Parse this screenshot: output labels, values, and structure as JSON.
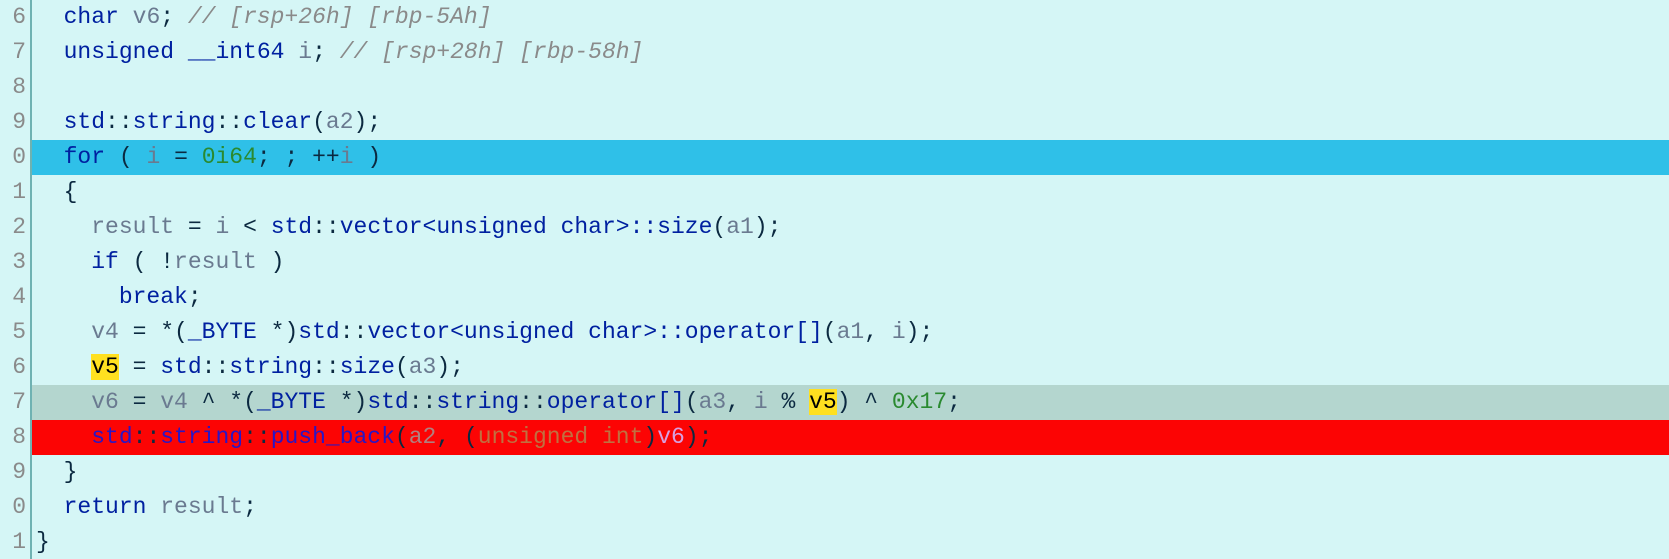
{
  "editor": {
    "first_line": 6,
    "lines": [
      {
        "num": "6",
        "row_class": "",
        "tokens": [
          {
            "cls": "",
            "t": "  "
          },
          {
            "cls": "tk-kw",
            "t": "char"
          },
          {
            "cls": "",
            "t": " "
          },
          {
            "cls": "tk-id",
            "t": "v6"
          },
          {
            "cls": "",
            "t": "; "
          },
          {
            "cls": "tk-cmt",
            "t": "// [rsp+26h] [rbp-5Ah]"
          }
        ]
      },
      {
        "num": "7",
        "row_class": "",
        "tokens": [
          {
            "cls": "",
            "t": "  "
          },
          {
            "cls": "tk-kw",
            "t": "unsigned"
          },
          {
            "cls": "",
            "t": " "
          },
          {
            "cls": "tk-kw",
            "t": "__int64"
          },
          {
            "cls": "",
            "t": " "
          },
          {
            "cls": "tk-id",
            "t": "i"
          },
          {
            "cls": "",
            "t": "; "
          },
          {
            "cls": "tk-cmt",
            "t": "// [rsp+28h] [rbp-58h]"
          }
        ]
      },
      {
        "num": "8",
        "row_class": "",
        "tokens": []
      },
      {
        "num": "9",
        "row_class": "",
        "tokens": [
          {
            "cls": "",
            "t": "  "
          },
          {
            "cls": "tk-func",
            "t": "std"
          },
          {
            "cls": "tk-punc",
            "t": "::"
          },
          {
            "cls": "tk-func",
            "t": "string"
          },
          {
            "cls": "tk-punc",
            "t": "::"
          },
          {
            "cls": "tk-func",
            "t": "clear"
          },
          {
            "cls": "tk-punc",
            "t": "("
          },
          {
            "cls": "tk-arg",
            "t": "a2"
          },
          {
            "cls": "tk-punc",
            "t": ");"
          }
        ]
      },
      {
        "num": "0",
        "row_class": "row-exec",
        "tokens": [
          {
            "cls": "",
            "t": "  "
          },
          {
            "cls": "tk-kw",
            "t": "for"
          },
          {
            "cls": "",
            "t": " ( "
          },
          {
            "cls": "tk-id",
            "t": "i"
          },
          {
            "cls": "",
            "t": " = "
          },
          {
            "cls": "tk-num",
            "t": "0i64"
          },
          {
            "cls": "",
            "t": "; ; ++"
          },
          {
            "cls": "tk-id",
            "t": "i"
          },
          {
            "cls": "",
            "t": " )"
          }
        ]
      },
      {
        "num": "1",
        "row_class": "",
        "tokens": [
          {
            "cls": "",
            "t": "  {"
          }
        ]
      },
      {
        "num": "2",
        "row_class": "",
        "tokens": [
          {
            "cls": "",
            "t": "    "
          },
          {
            "cls": "tk-id",
            "t": "result"
          },
          {
            "cls": "",
            "t": " = "
          },
          {
            "cls": "tk-id",
            "t": "i"
          },
          {
            "cls": "",
            "t": " < "
          },
          {
            "cls": "tk-func",
            "t": "std"
          },
          {
            "cls": "",
            "t": "::"
          },
          {
            "cls": "tk-func",
            "t": "vector<unsigned char>::size"
          },
          {
            "cls": "",
            "t": "("
          },
          {
            "cls": "tk-arg",
            "t": "a1"
          },
          {
            "cls": "",
            "t": ");"
          }
        ]
      },
      {
        "num": "3",
        "row_class": "",
        "tokens": [
          {
            "cls": "",
            "t": "    "
          },
          {
            "cls": "tk-kw",
            "t": "if"
          },
          {
            "cls": "",
            "t": " ( !"
          },
          {
            "cls": "tk-id",
            "t": "result"
          },
          {
            "cls": "",
            "t": " )"
          }
        ]
      },
      {
        "num": "4",
        "row_class": "",
        "tokens": [
          {
            "cls": "",
            "t": "      "
          },
          {
            "cls": "tk-kw",
            "t": "break"
          },
          {
            "cls": "",
            "t": ";"
          }
        ]
      },
      {
        "num": "5",
        "row_class": "",
        "tokens": [
          {
            "cls": "",
            "t": "    "
          },
          {
            "cls": "tk-id",
            "t": "v4"
          },
          {
            "cls": "",
            "t": " = *("
          },
          {
            "cls": "tk-type",
            "t": "_BYTE"
          },
          {
            "cls": "",
            "t": " *)"
          },
          {
            "cls": "tk-func",
            "t": "std"
          },
          {
            "cls": "",
            "t": "::"
          },
          {
            "cls": "tk-func",
            "t": "vector<unsigned char>::operator[]"
          },
          {
            "cls": "",
            "t": "("
          },
          {
            "cls": "tk-arg",
            "t": "a1"
          },
          {
            "cls": "",
            "t": ", "
          },
          {
            "cls": "tk-arg",
            "t": "i"
          },
          {
            "cls": "",
            "t": ");"
          }
        ]
      },
      {
        "num": "6",
        "row_class": "",
        "tokens": [
          {
            "cls": "",
            "t": "    "
          },
          {
            "cls": "tk-hl",
            "t": "v5"
          },
          {
            "cls": "",
            "t": " = "
          },
          {
            "cls": "tk-func",
            "t": "std"
          },
          {
            "cls": "",
            "t": "::"
          },
          {
            "cls": "tk-func",
            "t": "string"
          },
          {
            "cls": "",
            "t": "::"
          },
          {
            "cls": "tk-func",
            "t": "size"
          },
          {
            "cls": "",
            "t": "("
          },
          {
            "cls": "tk-arg",
            "t": "a3"
          },
          {
            "cls": "",
            "t": ");"
          }
        ]
      },
      {
        "num": "7",
        "row_class": "row-cursor",
        "tokens": [
          {
            "cls": "",
            "t": "    "
          },
          {
            "cls": "tk-id",
            "t": "v6"
          },
          {
            "cls": "",
            "t": " = "
          },
          {
            "cls": "tk-id",
            "t": "v4"
          },
          {
            "cls": "",
            "t": " ^ *("
          },
          {
            "cls": "tk-type",
            "t": "_BYTE"
          },
          {
            "cls": "",
            "t": " *)"
          },
          {
            "cls": "tk-func",
            "t": "std"
          },
          {
            "cls": "",
            "t": "::"
          },
          {
            "cls": "tk-func",
            "t": "string"
          },
          {
            "cls": "",
            "t": "::"
          },
          {
            "cls": "tk-func",
            "t": "operator[]"
          },
          {
            "cls": "",
            "t": "("
          },
          {
            "cls": "tk-arg",
            "t": "a3"
          },
          {
            "cls": "",
            "t": ", "
          },
          {
            "cls": "tk-arg",
            "t": "i"
          },
          {
            "cls": "",
            "t": " % "
          },
          {
            "cls": "tk-hl",
            "t": "v5"
          },
          {
            "cls": "",
            "t": ") ^ "
          },
          {
            "cls": "tk-num",
            "t": "0x17"
          },
          {
            "cls": "",
            "t": ";"
          }
        ]
      },
      {
        "num": "8",
        "row_class": "row-bp",
        "tokens": [
          {
            "cls": "",
            "t": "    "
          },
          {
            "cls": "tk-redkw",
            "t": "std"
          },
          {
            "cls": "",
            "t": "::"
          },
          {
            "cls": "tk-redkw",
            "t": "string"
          },
          {
            "cls": "",
            "t": "::"
          },
          {
            "cls": "tk-redkw",
            "t": "push_back"
          },
          {
            "cls": "",
            "t": "("
          },
          {
            "cls": "tk-redid",
            "t": "a2"
          },
          {
            "cls": "",
            "t": ", ("
          },
          {
            "cls": "tk-redcast",
            "t": "unsigned int"
          },
          {
            "cls": "",
            "t": ")"
          },
          {
            "cls": "tk-redv",
            "t": "v6"
          },
          {
            "cls": "",
            "t": ");"
          }
        ]
      },
      {
        "num": "9",
        "row_class": "",
        "tokens": [
          {
            "cls": "",
            "t": "  }"
          }
        ]
      },
      {
        "num": "0",
        "row_class": "",
        "tokens": [
          {
            "cls": "",
            "t": "  "
          },
          {
            "cls": "tk-kw",
            "t": "return"
          },
          {
            "cls": "",
            "t": " "
          },
          {
            "cls": "tk-id",
            "t": "result"
          },
          {
            "cls": "",
            "t": ";"
          }
        ]
      },
      {
        "num": "1",
        "row_class": "",
        "tokens": [
          {
            "cls": "",
            "t": "}"
          }
        ]
      }
    ]
  }
}
